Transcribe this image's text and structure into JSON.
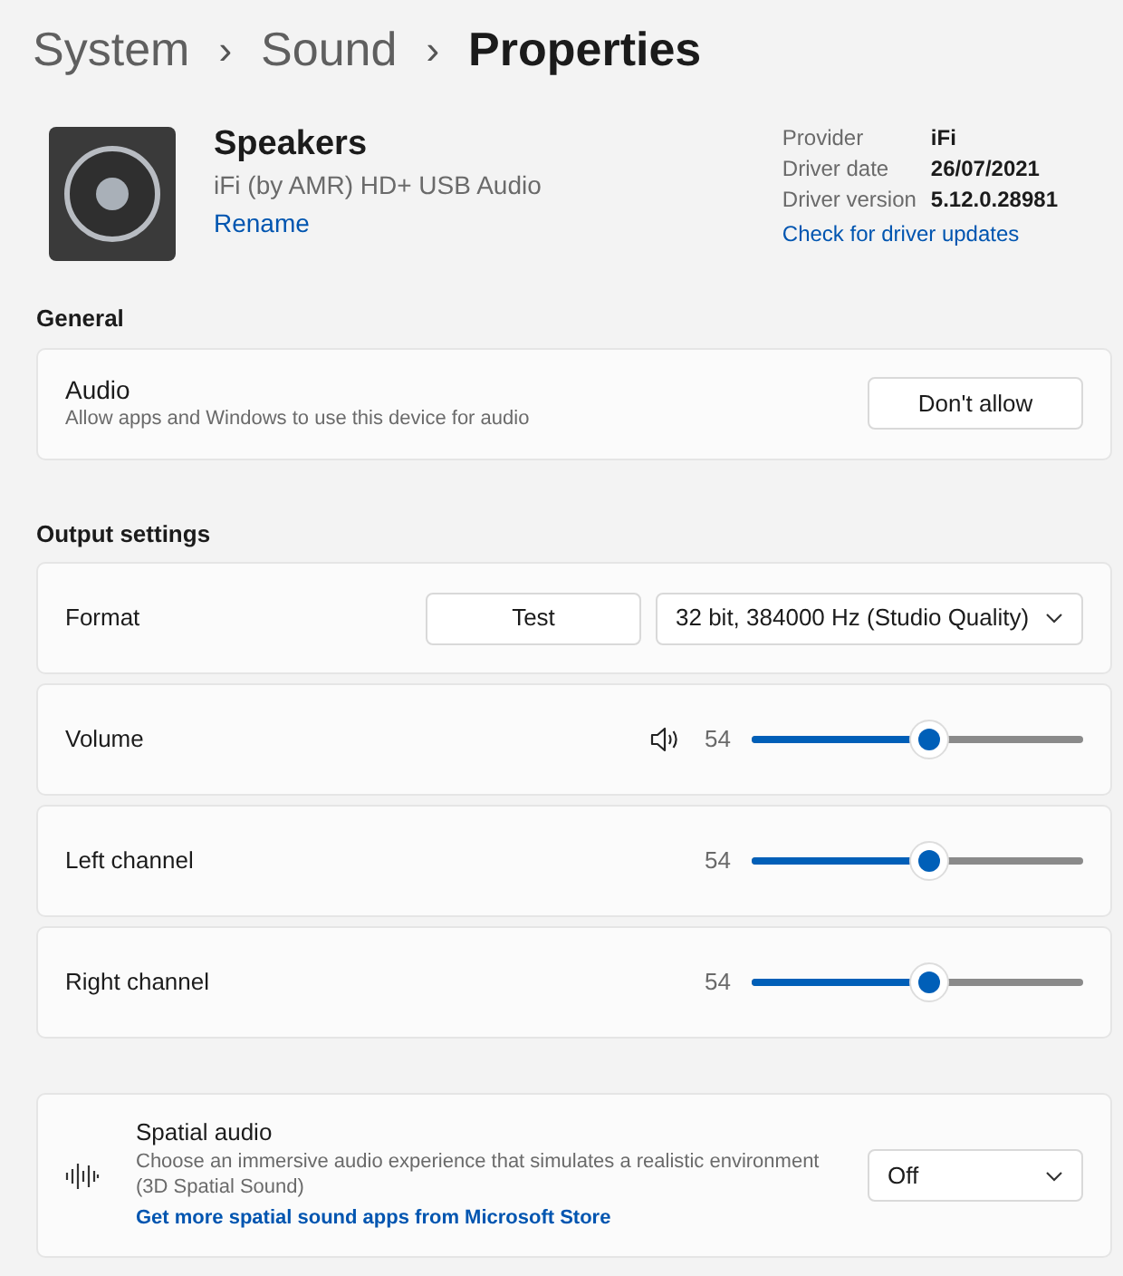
{
  "breadcrumb": [
    {
      "label": "System",
      "current": false
    },
    {
      "label": "Sound",
      "current": false
    },
    {
      "label": "Properties",
      "current": true
    }
  ],
  "separator": "›",
  "device": {
    "name": "Speakers",
    "description": "iFi (by AMR) HD+ USB Audio",
    "rename_link": "Rename"
  },
  "driver_info": [
    {
      "label": "Provider",
      "value": "iFi"
    },
    {
      "label": "Driver date",
      "value": "26/07/2021"
    },
    {
      "label": "Driver version",
      "value": "5.12.0.28981"
    }
  ],
  "driver_link": "Check for driver updates",
  "general": {
    "heading": "General",
    "audio": {
      "title": "Audio",
      "description": "Allow apps and Windows to use this device for audio",
      "button": "Don't allow"
    }
  },
  "output": {
    "heading": "Output settings",
    "rows": [
      {
        "kind": "format",
        "label": "Format",
        "button": "Test",
        "dropdown": "32 bit, 384000 Hz (Studio Quality)"
      },
      {
        "kind": "volume",
        "label": "Volume",
        "reading": "54",
        "level": 0.54
      },
      {
        "kind": "slider",
        "label": "Left channel",
        "reading": "54",
        "level": 0.54
      },
      {
        "kind": "slider",
        "label": "Right channel",
        "reading": "54",
        "level": 0.54
      }
    ]
  },
  "spatial": {
    "title": "Spatial audio",
    "description": "Choose an immersive audio experience that simulates a realistic environment (3D Spatial Sound)",
    "link": "Get more spatial sound apps from Microsoft Store",
    "dropdown": "Off"
  }
}
